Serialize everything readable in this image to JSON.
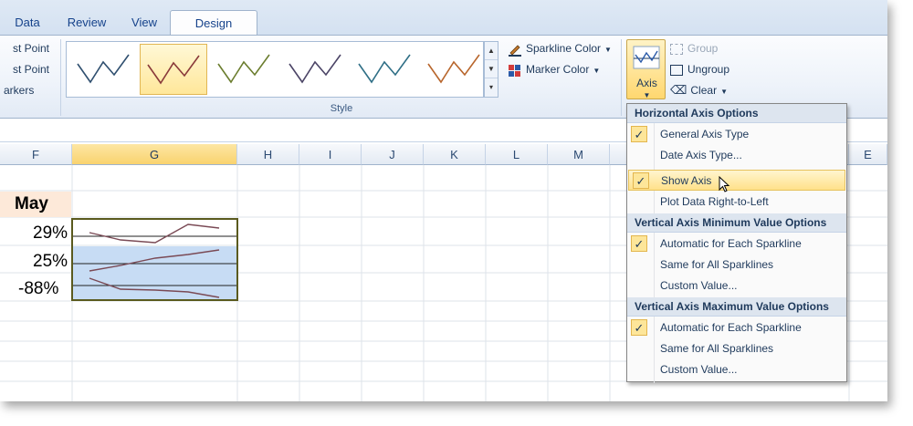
{
  "tabs": [
    "Data",
    "Review",
    "View",
    "Design"
  ],
  "ribbon": {
    "show_group_items": [
      "st Point",
      "st Point",
      "arkers"
    ],
    "style_group_label": "Style",
    "sparkline_color_label": "Sparkline Color",
    "marker_color_label": "Marker Color",
    "axis_label": "Axis",
    "group_label": "Group",
    "ungroup_label": "Ungroup",
    "clear_label": "Clear",
    "style_colors": [
      "#2f4f6f",
      "#8a3a3a",
      "#6b7d2e",
      "#4b4466",
      "#2f6f86",
      "#b8662c"
    ]
  },
  "columns": [
    "F",
    "G",
    "H",
    "I",
    "J",
    "K",
    "L",
    "M",
    "",
    "",
    "",
    "",
    "",
    "E"
  ],
  "sheet": {
    "header_cell": "May",
    "values": [
      "29%",
      "25%",
      "-88%"
    ]
  },
  "menu": {
    "sections": [
      {
        "heading": "Horizontal Axis Options",
        "items": [
          {
            "label": "General Axis Type",
            "checked": true
          },
          {
            "label": "Date Axis Type...",
            "checked": false
          },
          {
            "label": "Show Axis",
            "checked": true,
            "hover": true
          },
          {
            "label": "Plot Data Right-to-Left",
            "checked": false
          }
        ]
      },
      {
        "heading": "Vertical Axis Minimum Value Options",
        "items": [
          {
            "label": "Automatic for Each Sparkline",
            "checked": true
          },
          {
            "label": "Same for All Sparklines",
            "checked": false
          },
          {
            "label": "Custom Value...",
            "checked": false
          }
        ]
      },
      {
        "heading": "Vertical Axis Maximum Value Options",
        "items": [
          {
            "label": "Automatic for Each Sparkline",
            "checked": true
          },
          {
            "label": "Same for All Sparklines",
            "checked": false
          },
          {
            "label": "Custom Value...",
            "checked": false
          }
        ]
      }
    ]
  },
  "colors": {
    "accent": "#ffd76f",
    "selection": "#c7dcf4",
    "header_fill": "#fde9d9"
  }
}
